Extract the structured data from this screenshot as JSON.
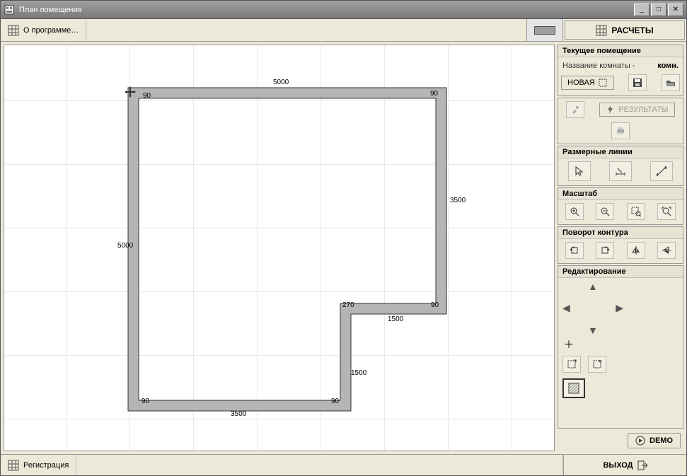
{
  "window": {
    "title": "План помещения",
    "min": "_",
    "max": "□",
    "close": "✕"
  },
  "toolbar": {
    "about": "О программе…",
    "calc": "РАСЧЕТЫ"
  },
  "panels": {
    "room": {
      "title": "Текущее помещение",
      "name_label": "Название комнаты -",
      "name_value": "комн.",
      "new_btn": "НОВАЯ"
    },
    "results": {
      "btn": "РЕЗУЛЬТАТЫ"
    },
    "dims": {
      "title": "Размерные линии"
    },
    "scale": {
      "title": "Масштаб"
    },
    "rotate": {
      "title": "Поворот контура"
    },
    "edit": {
      "title": "Редактирование"
    }
  },
  "demo": {
    "label": "DEMO"
  },
  "bottom": {
    "register": "Регистрация",
    "exit": "ВЫХОД"
  },
  "floorplan": {
    "dims": {
      "top_5000": "5000",
      "top_right_90": "90",
      "top_left_90": "90",
      "right_3500": "3500",
      "right_mid_90": "90",
      "mid_270": "270",
      "mid_1500_h": "1500",
      "mid_1500_v": "1500",
      "left_5000": "5000",
      "bottom_left_90": "90",
      "bottom_mid_90": "90",
      "bottom_3500": "3500"
    }
  }
}
